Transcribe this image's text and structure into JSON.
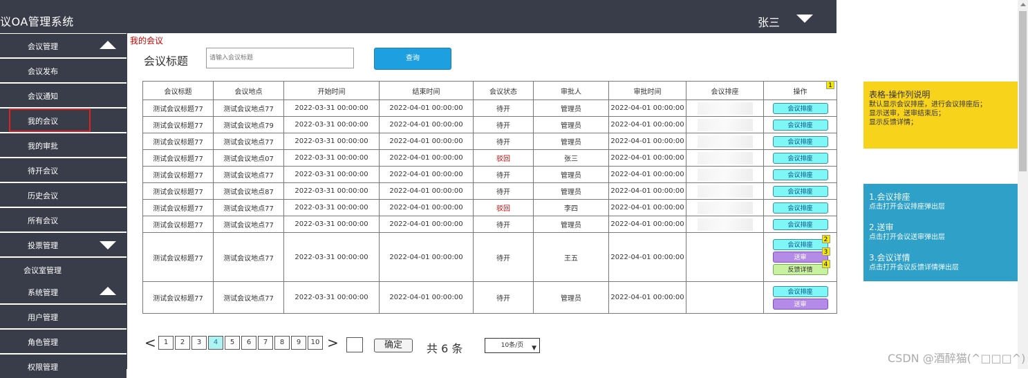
{
  "header": {
    "app_title": "议OA管理系统",
    "user_name": "张三"
  },
  "sidebar": {
    "items": [
      {
        "label": "会议管理",
        "type": "group",
        "state": "expanded"
      },
      {
        "label": "会议发布"
      },
      {
        "label": "会议通知"
      },
      {
        "label": "我的会议",
        "active": true
      },
      {
        "label": "我的审批"
      },
      {
        "label": "待开会议"
      },
      {
        "label": "历史会议"
      },
      {
        "label": "所有会议"
      },
      {
        "label": "投票管理",
        "type": "group",
        "state": "collapsed"
      },
      {
        "label": "会议室管理",
        "type": "group"
      },
      {
        "label": "系统管理",
        "type": "group",
        "state": "expanded"
      },
      {
        "label": "用户管理"
      },
      {
        "label": "角色管理"
      },
      {
        "label": "权限管理"
      }
    ]
  },
  "breadcrumb": "我的会议",
  "search": {
    "label": "会议标题",
    "placeholder": "请输入会议标题",
    "button": "查询"
  },
  "table": {
    "headers": [
      "会议标题",
      "会议地点",
      "开始时间",
      "结束时间",
      "会议状态",
      "审批人",
      "审批时间",
      "会议排座",
      "操作"
    ],
    "rows": [
      {
        "title": "测试会议标题77",
        "location": "测试会议地点77",
        "start": "2022-03-31 00:00:00",
        "end": "2022-04-01 00:00:00",
        "status": "待开",
        "approver": "管理员",
        "approved_at": "2022-04-01 00:00:00"
      },
      {
        "title": "测试会议标题77",
        "location": "测试会议地点79",
        "start": "2022-03-31 00:00:00",
        "end": "2022-04-01 00:00:00",
        "status": "待开",
        "approver": "管理员",
        "approved_at": "2022-04-01 00:00:00"
      },
      {
        "title": "测试会议标题77",
        "location": "测试会议地点77",
        "start": "2022-03-31 00:00:00",
        "end": "2022-04-01 00:00:00",
        "status": "待开",
        "approver": "管理员",
        "approved_at": "2022-04-01 00:00:00"
      },
      {
        "title": "测试会议标题77",
        "location": "测试会议地点07",
        "start": "2022-03-31 00:00:00",
        "end": "2022-04-01 00:00:00",
        "status": "驳回",
        "approver": "张三",
        "approved_at": "2022-04-01 00:00:00"
      },
      {
        "title": "测试会议标题77",
        "location": "测试会议地点77",
        "start": "2022-03-31 00:00:00",
        "end": "2022-04-01 00:00:00",
        "status": "待开",
        "approver": "管理员",
        "approved_at": "2022-04-01 00:00:00"
      },
      {
        "title": "测试会议标题77",
        "location": "测试会议地点87",
        "start": "2022-03-31 00:00:00",
        "end": "2022-04-01 00:00:00",
        "status": "待开",
        "approver": "管理员",
        "approved_at": "2022-04-01 00:00:00"
      },
      {
        "title": "测试会议标题77",
        "location": "测试会议地点77",
        "start": "2022-03-31 00:00:00",
        "end": "2022-04-01 00:00:00",
        "status": "驳回",
        "approver": "李四",
        "approved_at": "2022-04-01 00:00:00"
      },
      {
        "title": "测试会议标题77",
        "location": "测试会议地点77",
        "start": "2022-03-31 00:00:00",
        "end": "2022-04-01 00:00:00",
        "status": "待开",
        "approver": "管理员",
        "approved_at": "2022-04-01 00:00:00"
      },
      {
        "title": "测试会议标题77",
        "location": "测试会议地点77",
        "start": "2022-03-31 00:00:00",
        "end": "2022-04-01 00:00:00",
        "status": "待开",
        "approver": "王五",
        "approved_at": "2022-04-01 00:00:00"
      },
      {
        "title": "测试会议标题77",
        "location": "测试会议地点77",
        "start": "2022-03-31 00:00:00",
        "end": "2022-04-01 00:00:00",
        "status": "待开",
        "approver": "管理员",
        "approved_at": "2022-04-01 00:00:00"
      }
    ],
    "buttons": {
      "seat": "会议排座",
      "send": "送审",
      "feedback": "反馈详情"
    },
    "badges": [
      "1",
      "2",
      "3",
      "4"
    ]
  },
  "pagination": {
    "prev": "<",
    "next": ">",
    "pages": [
      "1",
      "2",
      "3",
      "4",
      "5",
      "6",
      "7",
      "8",
      "9",
      "10"
    ],
    "current": "4",
    "confirm": "确定",
    "total": "共 6 条",
    "page_size": "10条/页"
  },
  "notes": {
    "yellow": {
      "title": "表格-操作列说明",
      "lines": [
        "默认显示会议排座，进行会议排座后；",
        "显示送审，送审结束后；",
        "显示反馈详情；"
      ]
    },
    "blue": {
      "items": [
        {
          "title": "1.会议排座",
          "desc": "点击打开会议排座弹出层"
        },
        {
          "title": "2.送审",
          "desc": "点击打开会议送审弹出层"
        },
        {
          "title": "3.会议详情",
          "desc": "点击打开会议反馈详情弹出层"
        }
      ]
    }
  },
  "watermark": "CSDN @酒醉猫(^□□□^)",
  "colors": {
    "nav_bg": "#393d49",
    "primary_btn": "#1e9fe0",
    "seat_btn": "#7ff7f7",
    "send_btn": "#b48ce8",
    "feedback_btn": "#c8f2a0",
    "rejected": "#cc0000",
    "note_yellow": "#f8d31c",
    "note_blue": "#2fa0c7"
  }
}
